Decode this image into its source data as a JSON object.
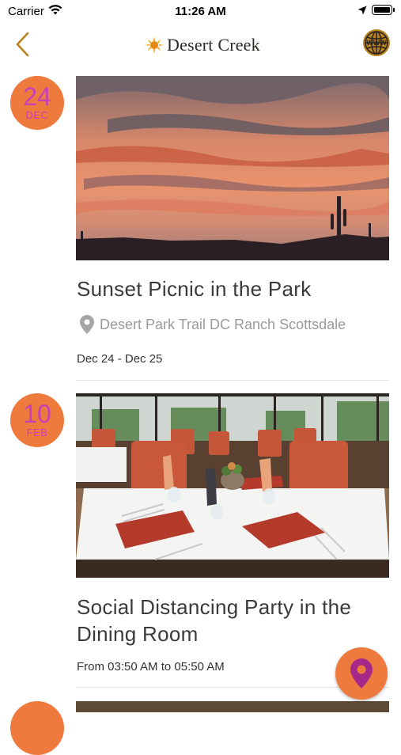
{
  "status_bar": {
    "carrier": "Carrier",
    "time": "11:26 AM"
  },
  "nav": {
    "back_icon": "chevron-left-icon",
    "logo_text": "Desert Creek",
    "globe_icon": "globe-icon",
    "accent_color": "#b8821f"
  },
  "events": [
    {
      "day": "24",
      "month": "DEC",
      "title": "Sunset Picnic in the Park",
      "location": "Desert Park Trail DC Ranch Scottsdale",
      "dates": "Dec 24 - Dec 25"
    },
    {
      "day": "10",
      "month": "FEB",
      "title": "Social Distancing Party in the Dining Room",
      "dates": "From 03:50 AM to 05:50 AM"
    }
  ],
  "fab": {
    "icon": "map-pin-icon"
  },
  "colors": {
    "badge_bg": "#ef7a3e",
    "badge_text": "#c93fb9",
    "fab_icon": "#a6288a"
  }
}
